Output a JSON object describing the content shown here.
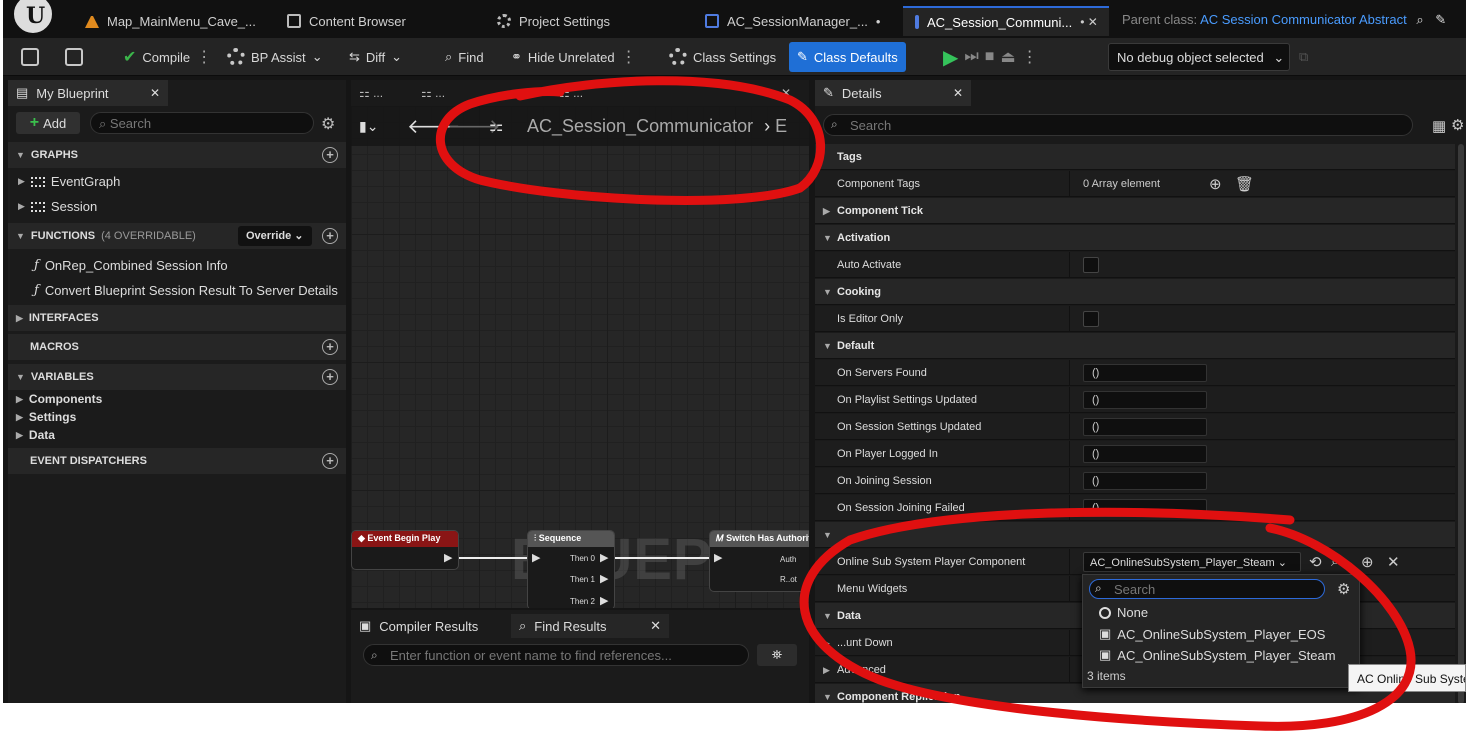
{
  "tabs": [
    {
      "label": "Map_MainMenu_Cave_...",
      "icon": "map-icon"
    },
    {
      "label": "Content Browser",
      "icon": "folder-icon"
    },
    {
      "label": "Project Settings",
      "icon": "settings-icon"
    },
    {
      "label": "AC_SessionManager_...",
      "suffix": "•",
      "icon": "blueprint-icon"
    },
    {
      "label": "AC_Session_Communi...",
      "suffix": "• ✕",
      "icon": "blueprint-icon"
    }
  ],
  "parent_class": {
    "label": "Parent class:",
    "value": "AC Session Communicator Abstract"
  },
  "toolbar": {
    "compile": "Compile",
    "bp_assist": "BP Assist",
    "diff": "Diff",
    "find": "Find",
    "hide_unrelated": "Hide Unrelated",
    "class_settings": "Class Settings",
    "class_defaults": "Class Defaults",
    "debug_object": "No debug object selected"
  },
  "my_blueprint": {
    "title": "My Blueprint",
    "add": "Add",
    "search_placeholder": "Search",
    "graphs_header": "GRAPHS",
    "graphs": [
      "EventGraph",
      "Session"
    ],
    "functions_header": "FUNCTIONS",
    "functions_sub": "(4 OVERRIDABLE)",
    "override": "Override",
    "functions": [
      "OnRep_Combined Session Info",
      "Convert Blueprint Session Result To Server Details"
    ],
    "interfaces_header": "INTERFACES",
    "macros_header": "MACROS",
    "variables_header": "VARIABLES",
    "variable_categories": [
      "Components",
      "Settings",
      "Data"
    ],
    "dispatchers_header": "EVENT DISPATCHERS"
  },
  "graph": {
    "breadcrumb": "AC_Session_Communicator",
    "breadcrumb_tail": "E",
    "watermark": "BLUEPRINT",
    "nodes": {
      "event_begin_play": "Event Begin Play",
      "sequence": "Sequence",
      "switch_authority": "Switch Has Authority",
      "then0": "Then 0",
      "then1": "Then 1",
      "then2": "Then 2",
      "auth": "Auth",
      "remote": "R..ot"
    }
  },
  "bottom": {
    "compiler_results": "Compiler Results",
    "find_results": "Find Results",
    "find_placeholder": "Enter function or event name to find references..."
  },
  "details": {
    "title": "Details",
    "search_placeholder": "Search",
    "rows": {
      "tags": "Tags",
      "component_tags": "Component Tags",
      "component_tags_value": "0 Array element",
      "component_tick": "Component Tick",
      "activation": "Activation",
      "auto_activate": "Auto Activate",
      "cooking": "Cooking",
      "is_editor_only": "Is Editor Only",
      "default": "Default",
      "on_servers_found": "On Servers Found",
      "on_playlist_settings_updated": "On Playlist Settings Updated",
      "on_session_settings_updated": "On Session Settings Updated",
      "on_player_logged_in": "On Player Logged In",
      "on_joining_session": "On Joining Session",
      "on_session_joining_failed": "On Session Joining Failed",
      "empty_value": "()",
      "online_sub_system": "Online Sub System Player Component",
      "online_sub_system_value": "AC_OnlineSubSystem_Player_Steam",
      "menu_widgets": "Menu Widgets",
      "data": "Data",
      "count_down": "...unt Down",
      "advanced": "Advanced",
      "component_replication": "Component Replication"
    }
  },
  "popup": {
    "search_placeholder": "Search",
    "items": [
      "None",
      "AC_OnlineSubSystem_Player_EOS",
      "AC_OnlineSubSystem_Player_Steam"
    ],
    "count": "3 items",
    "tooltip": "AC Online Sub System"
  },
  "colors": {
    "accent": "#1f6fd6",
    "annotation": "#e01010",
    "play": "#35c35b"
  }
}
